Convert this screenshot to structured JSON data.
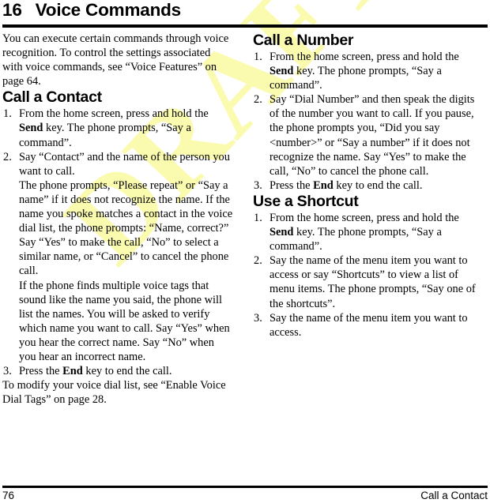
{
  "chapter": {
    "number": "16",
    "title": "Voice Commands"
  },
  "intro": {
    "paragraph": "You can execute certain commands through voice recognition. To control the settings associated with voice commands, see “Voice Features” on page 64."
  },
  "watermark": {
    "text": "DRAFT",
    "color": "#fbfbaf"
  },
  "sections": {
    "call_a_contact": {
      "heading": "Call a Contact",
      "steps": [
        {
          "text_before_key": "From the home screen, press and hold the ",
          "key": "Send",
          "text_after_key": " key. The phone prompts, “Say a command”."
        },
        {
          "text_before_key": "Say “Contact” and the name of the person you want to call.",
          "key": "",
          "text_after_key": "",
          "sub_paragraphs": [
            "The phone prompts, “Please repeat” or “Say a name” if it does not recognize the name. If the name you spoke matches a contact in the voice dial list, the phone prompts: “Name, correct?” Say “Yes” to make the call, “No” to select a similar name, or “Cancel” to cancel the phone call.",
            "If the phone finds multiple voice tags that sound like the name you said, the phone will list the names. You will be asked to verify which name you want to call. Say “Yes” when you hear the correct name. Say “No” when you hear an incorrect name."
          ]
        },
        {
          "text_before_key": "Press the ",
          "key": "End",
          "text_after_key": " key to end the call."
        }
      ],
      "closing_paragraph": "To modify your voice dial list, see “Enable Voice Dial Tags” on page 28."
    },
    "call_a_number": {
      "heading": "Call a Number",
      "steps": [
        {
          "text_before_key": "From the home screen, press and hold the ",
          "key": "Send",
          "text_after_key": " key. The phone prompts, “Say a command”."
        },
        {
          "text_before_key": "Say “Dial Number” and then speak the digits of the number you want to call. If you pause, the phone prompts you, “Did you say <number>” or “Say a number” if it does not recognize the name. Say “Yes” to make the call, “No” to cancel the phone call.",
          "key": "",
          "text_after_key": ""
        },
        {
          "text_before_key": "Press the ",
          "key": "End",
          "text_after_key": " key to end the call."
        }
      ]
    },
    "use_a_shortcut": {
      "heading": "Use a Shortcut",
      "steps": [
        {
          "text_before_key": "From the home screen, press and hold the ",
          "key": "Send",
          "text_after_key": " key. The phone prompts, “Say a command”."
        },
        {
          "text_before_key": "Say the name of the menu item you want to access or say “Shortcuts” to view a list of menu items. The phone prompts, “Say one of the shortcuts”.",
          "key": "",
          "text_after_key": ""
        },
        {
          "text_before_key": "Say the name of the menu item you want to access.",
          "key": "",
          "text_after_key": ""
        }
      ]
    }
  },
  "footer": {
    "page_number": "76",
    "running_head": "Call a Contact"
  }
}
